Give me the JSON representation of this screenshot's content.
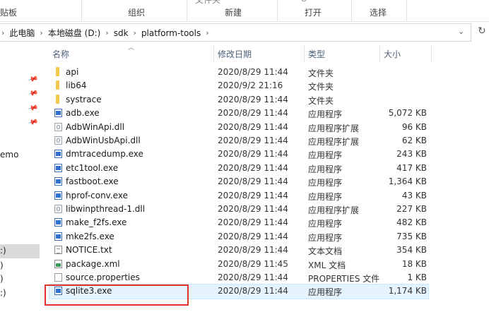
{
  "ribbon": {
    "groups": [
      "贴板",
      "组织",
      "新建",
      "打开",
      "选择"
    ],
    "cut_top": [
      "文件夹",
      "⊘"
    ]
  },
  "address": {
    "crumbs": [
      "此电脑",
      "本地磁盘 (D:)",
      "sdk",
      "platform-tools"
    ]
  },
  "nav": {
    "labels": [
      "emo",
      ":)",
      ")",
      ")",
      ":)"
    ]
  },
  "columns": {
    "name": "名称",
    "date": "修改日期",
    "type": "类型",
    "size": "大小"
  },
  "files": [
    {
      "name": "api",
      "date": "2020/8/29 11:44",
      "type": "文件夹",
      "size": "",
      "icon": "folder-icon"
    },
    {
      "name": "lib64",
      "date": "2020/9/2 21:16",
      "type": "文件夹",
      "size": "",
      "icon": "folder-icon"
    },
    {
      "name": "systrace",
      "date": "2020/8/29 11:44",
      "type": "文件夹",
      "size": "",
      "icon": "folder-icon"
    },
    {
      "name": "adb.exe",
      "date": "2020/8/29 11:44",
      "type": "应用程序",
      "size": "5,072 KB",
      "icon": "exe-icon"
    },
    {
      "name": "AdbWinApi.dll",
      "date": "2020/8/29 11:44",
      "type": "应用程序扩展",
      "size": "96 KB",
      "icon": "dll-icon"
    },
    {
      "name": "AdbWinUsbApi.dll",
      "date": "2020/8/29 11:44",
      "type": "应用程序扩展",
      "size": "62 KB",
      "icon": "dll-icon"
    },
    {
      "name": "dmtracedump.exe",
      "date": "2020/8/29 11:44",
      "type": "应用程序",
      "size": "243 KB",
      "icon": "exe-icon"
    },
    {
      "name": "etc1tool.exe",
      "date": "2020/8/29 11:44",
      "type": "应用程序",
      "size": "417 KB",
      "icon": "exe-icon"
    },
    {
      "name": "fastboot.exe",
      "date": "2020/8/29 11:44",
      "type": "应用程序",
      "size": "1,364 KB",
      "icon": "exe-icon"
    },
    {
      "name": "hprof-conv.exe",
      "date": "2020/8/29 11:44",
      "type": "应用程序",
      "size": "43 KB",
      "icon": "exe-icon"
    },
    {
      "name": "libwinpthread-1.dll",
      "date": "2020/8/29 11:44",
      "type": "应用程序扩展",
      "size": "227 KB",
      "icon": "dll-icon"
    },
    {
      "name": "make_f2fs.exe",
      "date": "2020/8/29 11:44",
      "type": "应用程序",
      "size": "482 KB",
      "icon": "exe-icon"
    },
    {
      "name": "mke2fs.exe",
      "date": "2020/8/29 11:44",
      "type": "应用程序",
      "size": "735 KB",
      "icon": "exe-icon"
    },
    {
      "name": "NOTICE.txt",
      "date": "2020/8/29 11:44",
      "type": "文本文档",
      "size": "354 KB",
      "icon": "text-file-icon"
    },
    {
      "name": "package.xml",
      "date": "2020/8/29 11:45",
      "type": "XML 文档",
      "size": "18 KB",
      "icon": "xml-file-icon"
    },
    {
      "name": "source.properties",
      "date": "2020/8/29 11:44",
      "type": "PROPERTIES 文件",
      "size": "1 KB",
      "icon": "file-icon"
    },
    {
      "name": "sqlite3.exe",
      "date": "2020/8/29 11:44",
      "type": "应用程序",
      "size": "1,174 KB",
      "icon": "exe-icon"
    }
  ],
  "colors": {
    "selected_row_bg": "#e5f3ff",
    "highlight_box": "#e0312c",
    "header_text": "#4c607a"
  }
}
